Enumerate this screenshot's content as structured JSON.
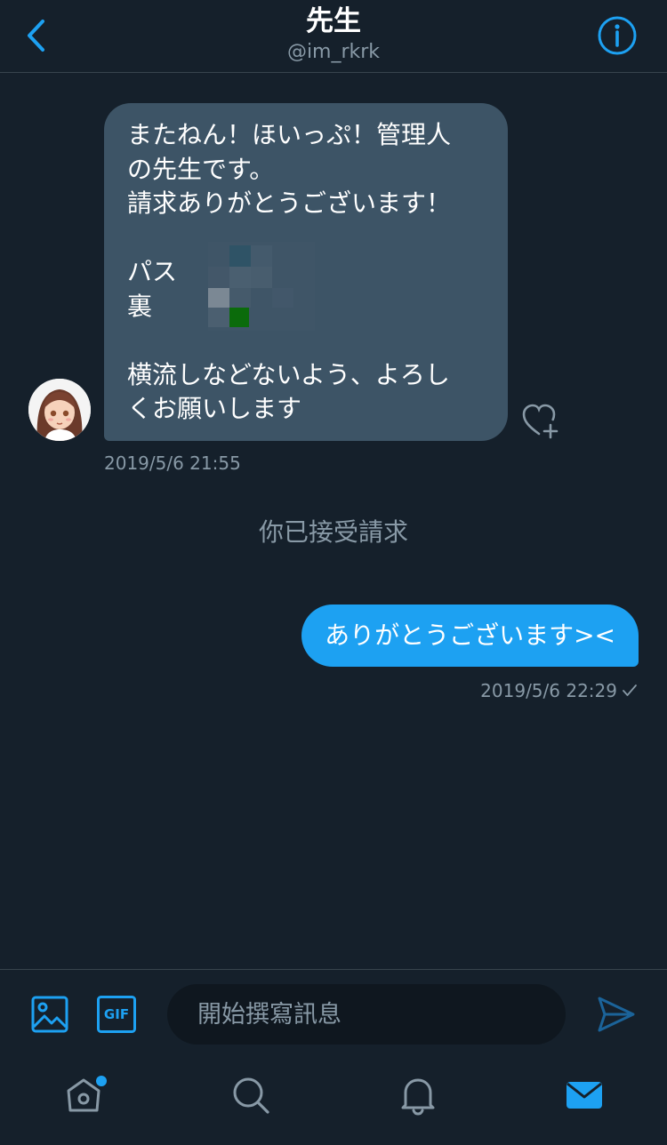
{
  "header": {
    "title": "先生",
    "handle": "@im_rkrk"
  },
  "incoming": {
    "lines": [
      "またねん！ほいっぷ！管理人",
      "の先生です。",
      "請求ありがとうございます！",
      "",
      "パス",
      "裏",
      "",
      "横流しなどないよう、よろし",
      "くお願いします"
    ],
    "timestamp": "2019/5/6 21:55"
  },
  "system_note": "你已接受請求",
  "outgoing": {
    "text": "ありがとうございます><",
    "timestamp": "2019/5/6 22:29",
    "status_icon": "check-icon"
  },
  "composer": {
    "placeholder": "開始撰寫訊息",
    "gif_label": "GIF"
  },
  "colors": {
    "background": "#15202b",
    "accent": "#1da1f2",
    "incoming_bubble": "#3d5466",
    "muted_text": "#8899a6",
    "divider": "#38444d"
  },
  "tabs": [
    "home-icon",
    "search-icon",
    "notifications-icon",
    "messages-icon"
  ]
}
